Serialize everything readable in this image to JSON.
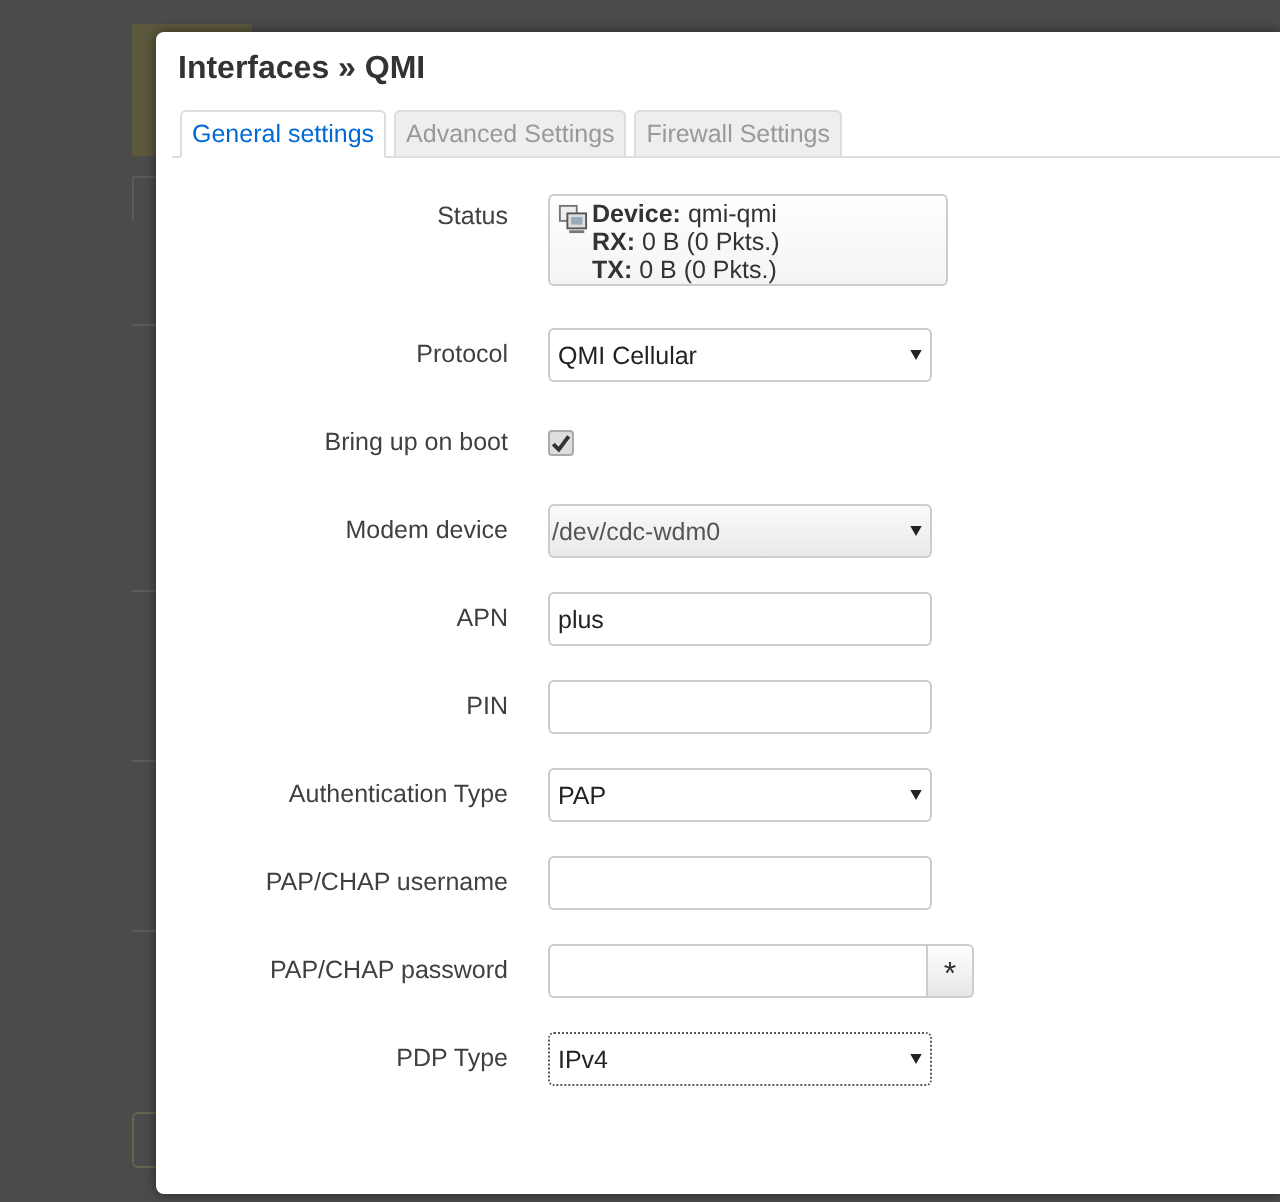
{
  "dialog": {
    "title": "Interfaces » QMI",
    "tabs": [
      {
        "label": "General settings",
        "selected": true
      },
      {
        "label": "Advanced Settings",
        "selected": false
      },
      {
        "label": "Firewall Settings",
        "selected": false
      }
    ],
    "fields": [
      {
        "kind": "status",
        "label": "Status",
        "lines": [
          "**Device:** qmi-qmi",
          "**RX:** 0 B (0 Pkts.)",
          "**TX:** 0 B (0 Pkts.)"
        ]
      },
      {
        "kind": "select",
        "label": "Protocol",
        "value": "QMI Cellular",
        "focused": false
      },
      {
        "kind": "checkbox",
        "label": "Bring up on boot",
        "checked": true
      },
      {
        "kind": "combo",
        "label": "Modem device",
        "value": "/dev/cdc-wdm0",
        "focused": false
      },
      {
        "kind": "text",
        "label": "APN",
        "value": "plus",
        "focused": false
      },
      {
        "kind": "text",
        "label": "PIN",
        "focused": false
      },
      {
        "kind": "select",
        "label": "Authentication Type",
        "value": "PAP",
        "focused": false
      },
      {
        "kind": "text",
        "label": "PAP/CHAP username",
        "focused": false
      },
      {
        "kind": "password",
        "label": "PAP/CHAP password",
        "reveal": "*",
        "focused": false
      },
      {
        "kind": "select",
        "label": "PDP Type",
        "value": "IPv4",
        "focused": true
      }
    ]
  }
}
